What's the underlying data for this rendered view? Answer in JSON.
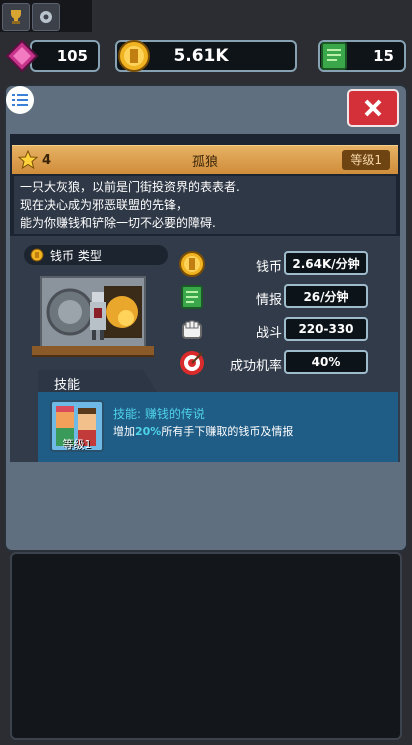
{
  "resources": {
    "gems": "105",
    "coins": "5.61K",
    "intel": "15"
  },
  "character": {
    "stars": "4",
    "name": "孤狼",
    "level": "等级1",
    "description": [
      "一只大灰狼，以前是门街投资界的表表者.",
      "现在决心成为邪恶联盟的先锋，",
      "能为你赚钱和铲除一切不必要的障碍."
    ],
    "type": "钱币 类型"
  },
  "stats": [
    {
      "icon": "coin-icon",
      "label": "钱币",
      "value": "2.64K/分钟"
    },
    {
      "icon": "intel-icon",
      "label": "情报",
      "value": "26/分钟"
    },
    {
      "icon": "fist-icon",
      "label": "战斗",
      "value": "220-330"
    },
    {
      "icon": "target-icon",
      "label": "成功机率",
      "value": "40%"
    }
  ],
  "skill": {
    "tab": "技能",
    "title": "技能: 赚钱的传说",
    "desc_pre": "增加",
    "desc_pct": "20%",
    "desc_post": "所有手下赚取的钱币及情报",
    "level": "等级1"
  },
  "colors": {
    "header": "#e0a04f",
    "close": "#d3303a",
    "accent_text": "#4fd3e8"
  }
}
